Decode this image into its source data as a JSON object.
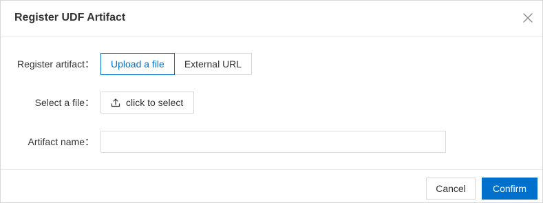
{
  "dialog": {
    "title": "Register UDF Artifact"
  },
  "form": {
    "register_artifact": {
      "label": "Register artifact：",
      "options": [
        "Upload a file",
        "External URL"
      ],
      "selected": "Upload a file"
    },
    "select_file": {
      "label": "Select a file：",
      "button_label": "click to select"
    },
    "artifact_name": {
      "label": "Artifact name：",
      "value": "",
      "placeholder": ""
    }
  },
  "footer": {
    "cancel_label": "Cancel",
    "confirm_label": "Confirm"
  },
  "colors": {
    "accent": "#0070cc",
    "border": "#d9d9d9",
    "text": "#333333"
  },
  "icons": {
    "close": "close-icon",
    "upload": "upload-icon"
  }
}
